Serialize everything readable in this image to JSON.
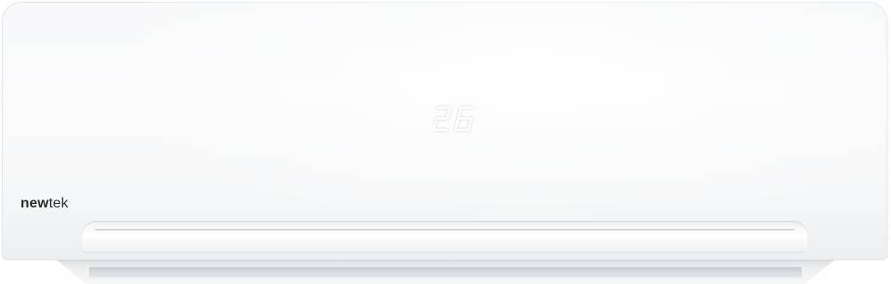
{
  "product": {
    "brand_part_1": "new",
    "brand_part_2": "tek",
    "display_temperature": "26",
    "display_color": "#ffffff",
    "body_color": "#f7f8f9"
  }
}
